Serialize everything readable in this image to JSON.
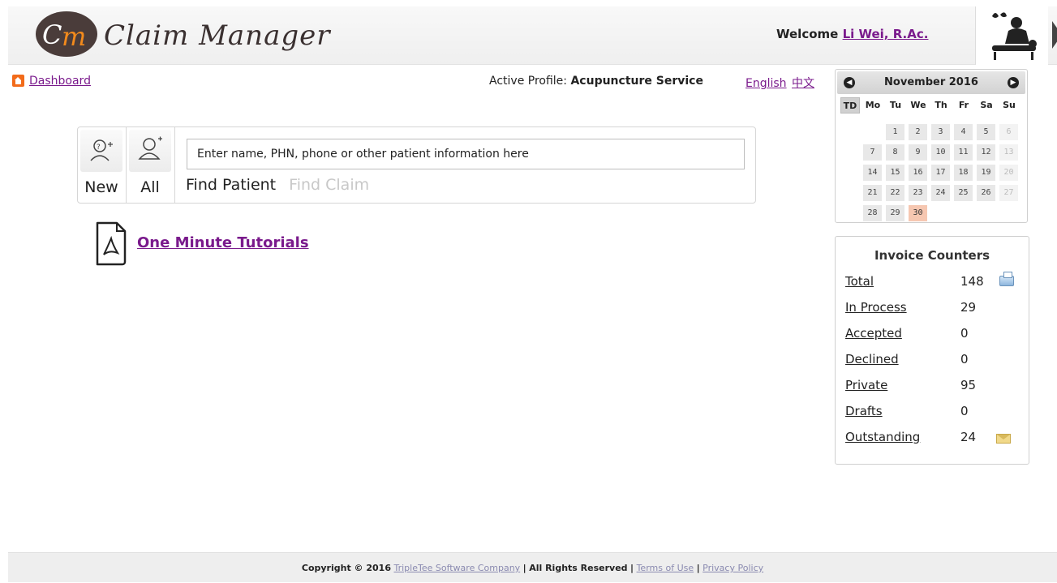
{
  "header": {
    "logo_text": "Claim Manager",
    "welcome_prefix": "Welcome",
    "user_name": "Li Wei, R.Ac."
  },
  "topbar": {
    "dashboard_link": "Dashboard",
    "active_profile_label": "Active Profile:",
    "active_profile_value": "Acupuncture Service",
    "lang_english": "English",
    "lang_chinese": "中文"
  },
  "search": {
    "new_label": "New",
    "all_label": "All",
    "placeholder": "Enter name, PHN, phone or other patient information here",
    "tab_find_patient": "Find Patient",
    "tab_find_claim": "Find Claim"
  },
  "tutorial": {
    "link_text": "One Minute Tutorials"
  },
  "calendar": {
    "title": "November 2016",
    "today_label": "TD",
    "weekdays": [
      "Mo",
      "Tu",
      "We",
      "Th",
      "Fr",
      "Sa",
      "Su"
    ],
    "weeks": [
      [
        "",
        "1",
        "2",
        "3",
        "4",
        "5",
        "6"
      ],
      [
        "7",
        "8",
        "9",
        "10",
        "11",
        "12",
        "13"
      ],
      [
        "14",
        "15",
        "16",
        "17",
        "18",
        "19",
        "20"
      ],
      [
        "21",
        "22",
        "23",
        "24",
        "25",
        "26",
        "27"
      ],
      [
        "28",
        "29",
        "30",
        "",
        "",
        "",
        ""
      ]
    ],
    "today": "30",
    "today_color": "#f6c7b1"
  },
  "counters": {
    "title": "Invoice Counters",
    "rows": [
      {
        "label": "Total",
        "value": "148",
        "icon": "print-icon"
      },
      {
        "label": "In Process",
        "value": "29"
      },
      {
        "label": "Accepted",
        "value": "0"
      },
      {
        "label": "Declined",
        "value": "0"
      },
      {
        "label": "Private",
        "value": "95"
      },
      {
        "label": "Drafts",
        "value": "0"
      },
      {
        "label": "Outstanding",
        "value": "24",
        "icon": "mail-icon"
      }
    ]
  },
  "footer": {
    "copyright": "Copyright © 2016",
    "company": "TripleTee Software Company",
    "sep1": "|",
    "rights": "All Rights Reserved",
    "sep2": "|",
    "terms": "Terms of Use",
    "sep3": "|",
    "privacy": "Privacy Policy"
  },
  "colors": {
    "link": "#7a1a8c",
    "accent_orange": "#f26b1a"
  }
}
